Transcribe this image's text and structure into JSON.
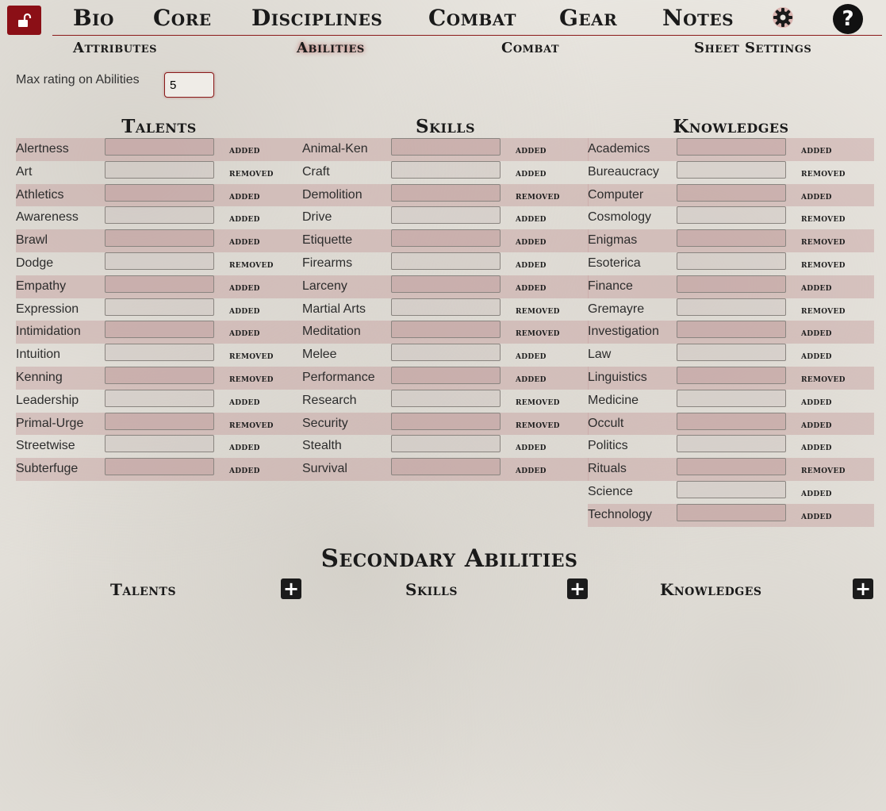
{
  "nav": {
    "tabs": [
      "Bio",
      "Core",
      "Disciplines",
      "Combat",
      "Gear",
      "Notes"
    ],
    "lock_icon": "unlock-icon",
    "settings_icon": "gear-icon",
    "help_label": "?"
  },
  "subnav": {
    "items": [
      "Attributes",
      "Abilities",
      "Combat",
      "Sheet Settings"
    ],
    "active": "Abilities"
  },
  "max_rating": {
    "label": "Max rating on Abilities",
    "value": "5"
  },
  "columns": {
    "talents": {
      "title": "Talents",
      "rows": [
        {
          "name": "Alertness",
          "status": "added"
        },
        {
          "name": "Art",
          "status": "removed"
        },
        {
          "name": "Athletics",
          "status": "added"
        },
        {
          "name": "Awareness",
          "status": "added"
        },
        {
          "name": "Brawl",
          "status": "added"
        },
        {
          "name": "Dodge",
          "status": "removed"
        },
        {
          "name": "Empathy",
          "status": "added"
        },
        {
          "name": "Expression",
          "status": "added"
        },
        {
          "name": "Intimidation",
          "status": "added"
        },
        {
          "name": "Intuition",
          "status": "removed"
        },
        {
          "name": "Kenning",
          "status": "removed"
        },
        {
          "name": "Leadership",
          "status": "added"
        },
        {
          "name": "Primal-Urge",
          "status": "removed"
        },
        {
          "name": "Streetwise",
          "status": "added"
        },
        {
          "name": "Subterfuge",
          "status": "added"
        }
      ]
    },
    "skills": {
      "title": "Skills",
      "rows": [
        {
          "name": "Animal-Ken",
          "status": "added"
        },
        {
          "name": "Craft",
          "status": "added"
        },
        {
          "name": "Demolition",
          "status": "removed"
        },
        {
          "name": "Drive",
          "status": "added"
        },
        {
          "name": "Etiquette",
          "status": "added"
        },
        {
          "name": "Firearms",
          "status": "added"
        },
        {
          "name": "Larceny",
          "status": "added"
        },
        {
          "name": "Martial Arts",
          "status": "removed"
        },
        {
          "name": "Meditation",
          "status": "removed"
        },
        {
          "name": "Melee",
          "status": "added"
        },
        {
          "name": "Performance",
          "status": "added"
        },
        {
          "name": "Research",
          "status": "removed"
        },
        {
          "name": "Security",
          "status": "removed"
        },
        {
          "name": "Stealth",
          "status": "added"
        },
        {
          "name": "Survival",
          "status": "added"
        }
      ]
    },
    "knowledges": {
      "title": "Knowledges",
      "rows": [
        {
          "name": "Academics",
          "status": "added"
        },
        {
          "name": "Bureaucracy",
          "status": "removed"
        },
        {
          "name": "Computer",
          "status": "added"
        },
        {
          "name": "Cosmology",
          "status": "removed"
        },
        {
          "name": "Enigmas",
          "status": "removed"
        },
        {
          "name": "Esoterica",
          "status": "removed"
        },
        {
          "name": "Finance",
          "status": "added"
        },
        {
          "name": "Gremayre",
          "status": "removed"
        },
        {
          "name": "Investigation",
          "status": "added"
        },
        {
          "name": "Law",
          "status": "added"
        },
        {
          "name": "Linguistics",
          "status": "removed"
        },
        {
          "name": "Medicine",
          "status": "added"
        },
        {
          "name": "Occult",
          "status": "added"
        },
        {
          "name": "Politics",
          "status": "added"
        },
        {
          "name": "Rituals",
          "status": "removed"
        },
        {
          "name": "Science",
          "status": "added"
        },
        {
          "name": "Technology",
          "status": "added"
        }
      ]
    }
  },
  "secondary": {
    "title": "Secondary Abilities",
    "talents": "Talents",
    "skills": "Skills",
    "knowledges": "Knowledges",
    "add_icon": "plus-icon",
    "add_label": "+"
  },
  "colors": {
    "accent": "#8b0f16",
    "row_shade": "#d3b4b2",
    "background": "#e9e6e0"
  }
}
